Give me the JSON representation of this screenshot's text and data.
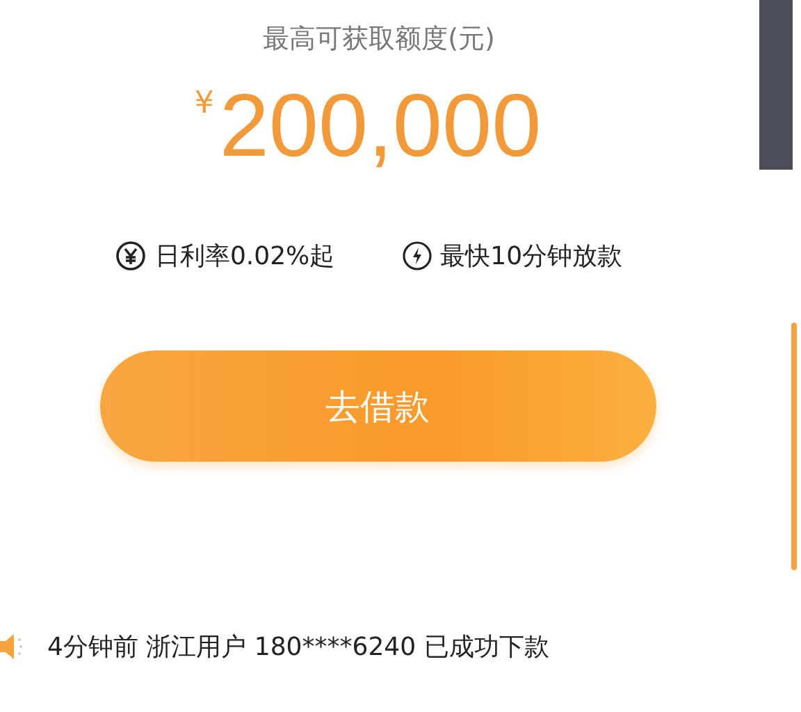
{
  "limit_label": "最高可获取额度(元)",
  "currency": "¥",
  "amount": "200,000",
  "features": [
    {
      "kind": "yuan",
      "text": "日利率0.02%起"
    },
    {
      "kind": "bolt",
      "text": "最快10分钟放款"
    }
  ],
  "borrow_button": "去借款",
  "ticker": "4分钟前 浙江用户 180****6240 已成功下款"
}
